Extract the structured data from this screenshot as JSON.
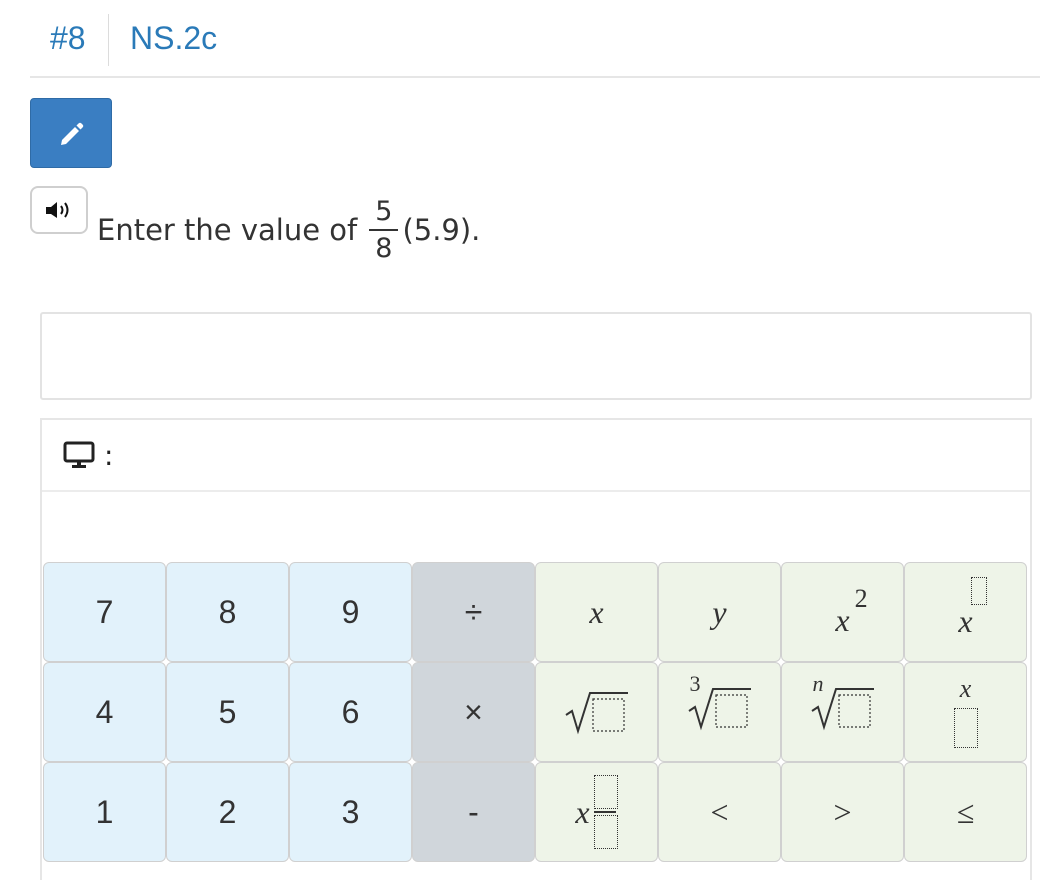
{
  "header": {
    "question_number": "#8",
    "standard": "NS.2c"
  },
  "question": {
    "prefix": "Enter the value of",
    "numerator": "5",
    "denominator": "8",
    "suffix": "(5.9)."
  },
  "answer": {
    "value": ""
  },
  "keypad": {
    "header_colon": ":",
    "digits": {
      "k7": "7",
      "k8": "8",
      "k9": "9",
      "k4": "4",
      "k5": "5",
      "k6": "6",
      "k1": "1",
      "k2": "2",
      "k3": "3"
    },
    "operators": {
      "divide": "÷",
      "multiply": "×",
      "minus": "-"
    },
    "functions": {
      "x": "x",
      "y": "y",
      "x_squared_base": "x",
      "x_squared_exp": "2",
      "x_power_base": "x",
      "cbrt_index": "3",
      "nthroot_index": "n",
      "x_over_box": "x",
      "x_sub_box": "x",
      "less": "<",
      "greater": ">",
      "less_equal": "≤"
    }
  },
  "colors": {
    "accent": "#2a7ab8",
    "button_blue": "#3a7ec2",
    "digit_key": "#e2f2fb",
    "op_key": "#d0d6db",
    "fn_key": "#eef4e8"
  }
}
